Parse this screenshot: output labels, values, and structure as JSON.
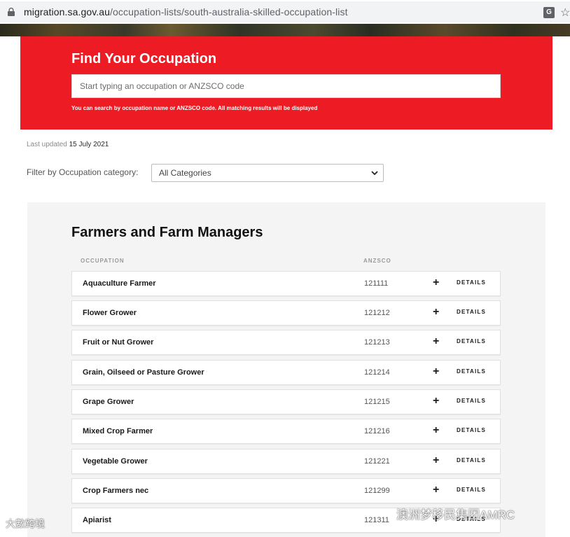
{
  "browser": {
    "url_host": "migration.sa.gov.au",
    "url_path": "/occupation-lists/south-australia-skilled-occupation-list",
    "icons": [
      "lock-icon",
      "translate-icon",
      "star-icon"
    ]
  },
  "search": {
    "title": "Find Your Occupation",
    "placeholder": "Start typing an occupation or ANZSCO code",
    "hint": "You can search by occupation name or ANZSCO code. All matching results will be displayed",
    "accent_color": "#ed1c24"
  },
  "meta": {
    "last_updated_label": "Last updated",
    "last_updated_date": "15 July 2021"
  },
  "filter": {
    "label": "Filter by Occupation category:",
    "selected": "All Categories"
  },
  "section": {
    "title": "Farmers and Farm Managers",
    "col_occupation": "OCCUPATION",
    "col_anzsco": "ANZSCO",
    "details_label": "DETAILS",
    "rows": [
      {
        "occupation": "Aquaculture Farmer",
        "code": "121111"
      },
      {
        "occupation": "Flower Grower",
        "code": "121212"
      },
      {
        "occupation": "Fruit or Nut Grower",
        "code": "121213"
      },
      {
        "occupation": "Grain, Oilseed or Pasture Grower",
        "code": "121214"
      },
      {
        "occupation": "Grape Grower",
        "code": "121215"
      },
      {
        "occupation": "Mixed Crop Farmer",
        "code": "121216"
      },
      {
        "occupation": "Vegetable Grower",
        "code": "121221"
      },
      {
        "occupation": "Crop Farmers nec",
        "code": "121299"
      },
      {
        "occupation": "Apiarist",
        "code": "121311"
      }
    ]
  },
  "watermarks": {
    "left": "大數跨境",
    "right": "澳洲梦移民集团AMRC"
  }
}
